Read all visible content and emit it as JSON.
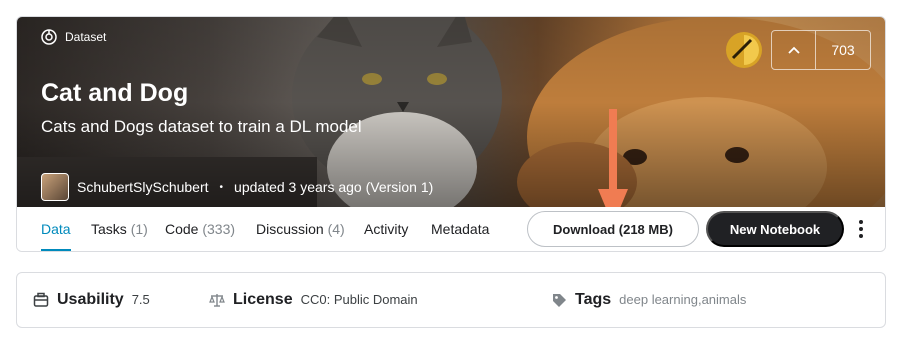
{
  "header": {
    "type_label": "Dataset",
    "title": "Cat and Dog",
    "subtitle": "Cats and Dogs dataset to train a DL model",
    "author": "SchubertSlySchubert",
    "updated": "updated 3 years ago (Version 1)",
    "vote_count": "703",
    "medal_color": "#d8a326"
  },
  "tabs": [
    {
      "label": "Data",
      "count": ""
    },
    {
      "label": "Tasks",
      "count": "(1)"
    },
    {
      "label": "Code",
      "count": "(333)"
    },
    {
      "label": "Discussion",
      "count": "(4)"
    },
    {
      "label": "Activity",
      "count": ""
    },
    {
      "label": "Metadata",
      "count": ""
    }
  ],
  "actions": {
    "download_label": "Download (218 MB)",
    "new_notebook_label": "New Notebook"
  },
  "info": {
    "usability_label": "Usability",
    "usability_value": "7.5",
    "license_label": "License",
    "license_value": "CC0: Public Domain",
    "tags_label": "Tags",
    "tags": [
      "deep learning",
      "animals"
    ],
    "tag_separator": ", "
  },
  "colors": {
    "accent": "#008abc",
    "annotation_arrow": "#f07c52",
    "button_dark": "#202124"
  }
}
